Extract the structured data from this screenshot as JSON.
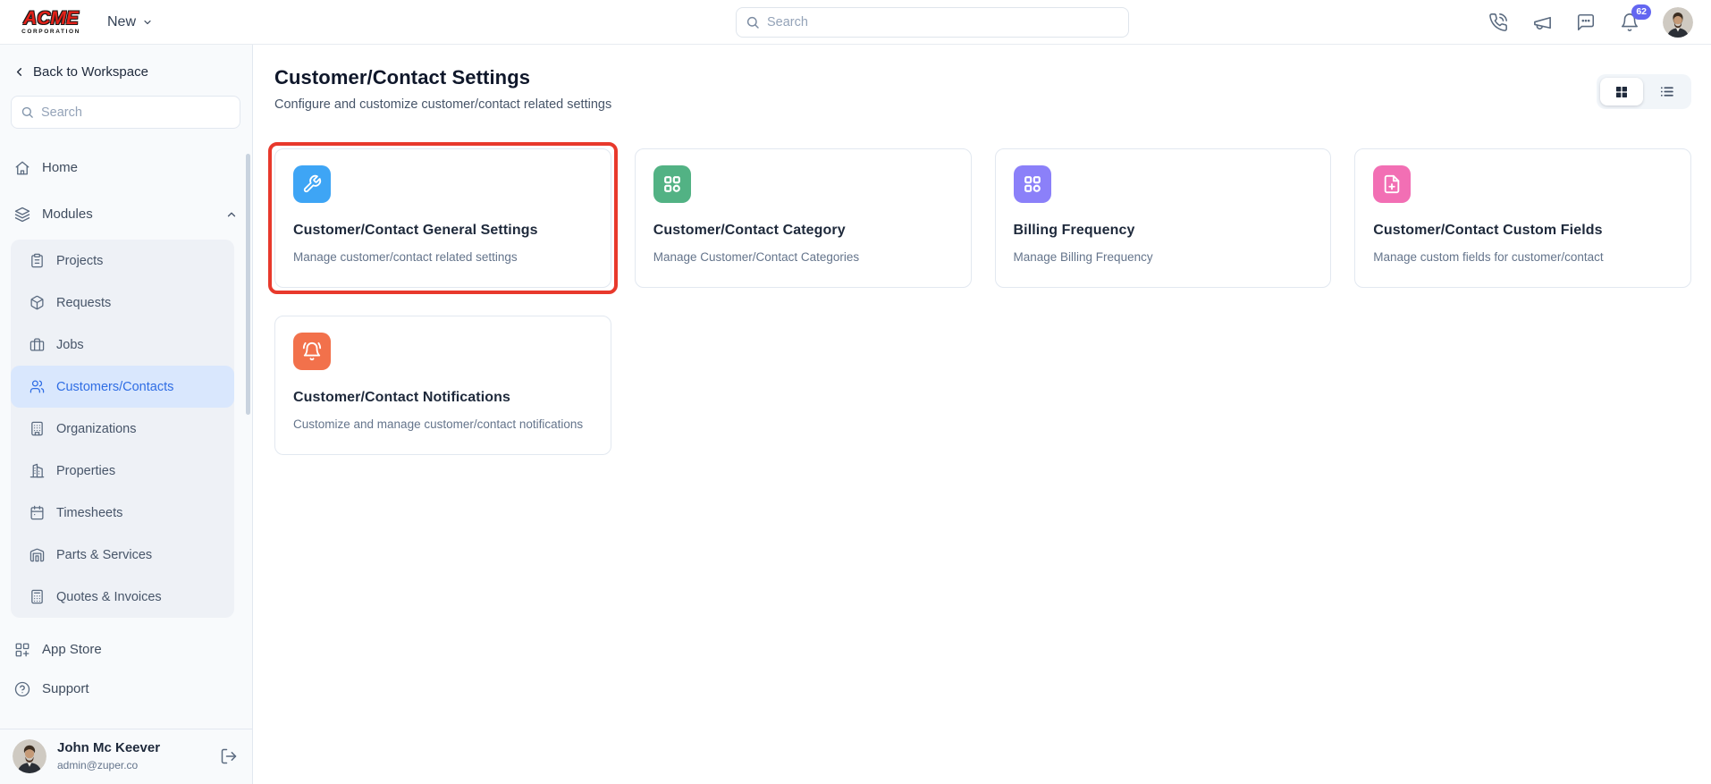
{
  "header": {
    "logo_line1": "ACME",
    "logo_line2": "CORPORATION",
    "new_label": "New",
    "search_placeholder": "Search",
    "notification_count": "62"
  },
  "sidebar": {
    "back_label": "Back to Workspace",
    "search_placeholder": "Search",
    "home_label": "Home",
    "modules_label": "Modules",
    "module_items": [
      "Projects",
      "Requests",
      "Jobs",
      "Customers/Contacts",
      "Organizations",
      "Properties",
      "Timesheets",
      "Parts & Services",
      "Quotes & Invoices"
    ],
    "active_module": "Customers/Contacts",
    "app_store_label": "App Store",
    "support_label": "Support",
    "user_name": "John Mc Keever",
    "user_email": "admin@zuper.co"
  },
  "main": {
    "title": "Customer/Contact Settings",
    "subtitle": "Configure and customize customer/contact related settings",
    "cards": [
      {
        "title": "Customer/Contact General Settings",
        "description": "Manage customer/contact related settings",
        "icon": "wrench-icon",
        "color": "#3ea5f5",
        "highlighted": true
      },
      {
        "title": "Customer/Contact Category",
        "description": "Manage Customer/Contact Categories",
        "icon": "category-icon",
        "color": "#52b284",
        "highlighted": false
      },
      {
        "title": "Billing Frequency",
        "description": "Manage Billing Frequency",
        "icon": "category-icon",
        "color": "#8b80f9",
        "highlighted": false
      },
      {
        "title": "Customer/Contact Custom Fields",
        "description": "Manage custom fields for customer/contact",
        "icon": "file-plus-icon",
        "color": "#f26fb4",
        "highlighted": false
      },
      {
        "title": "Customer/Contact Notifications",
        "description": "Customize and manage customer/contact notifications",
        "icon": "bell-ring-icon",
        "color": "#f2714b",
        "highlighted": false
      }
    ]
  },
  "colors": {
    "active_item_bg": "#d9e7fd",
    "active_item_text": "#2f6de4",
    "notification_badge": "#6366f1",
    "annotation_red": "#e8392c"
  }
}
